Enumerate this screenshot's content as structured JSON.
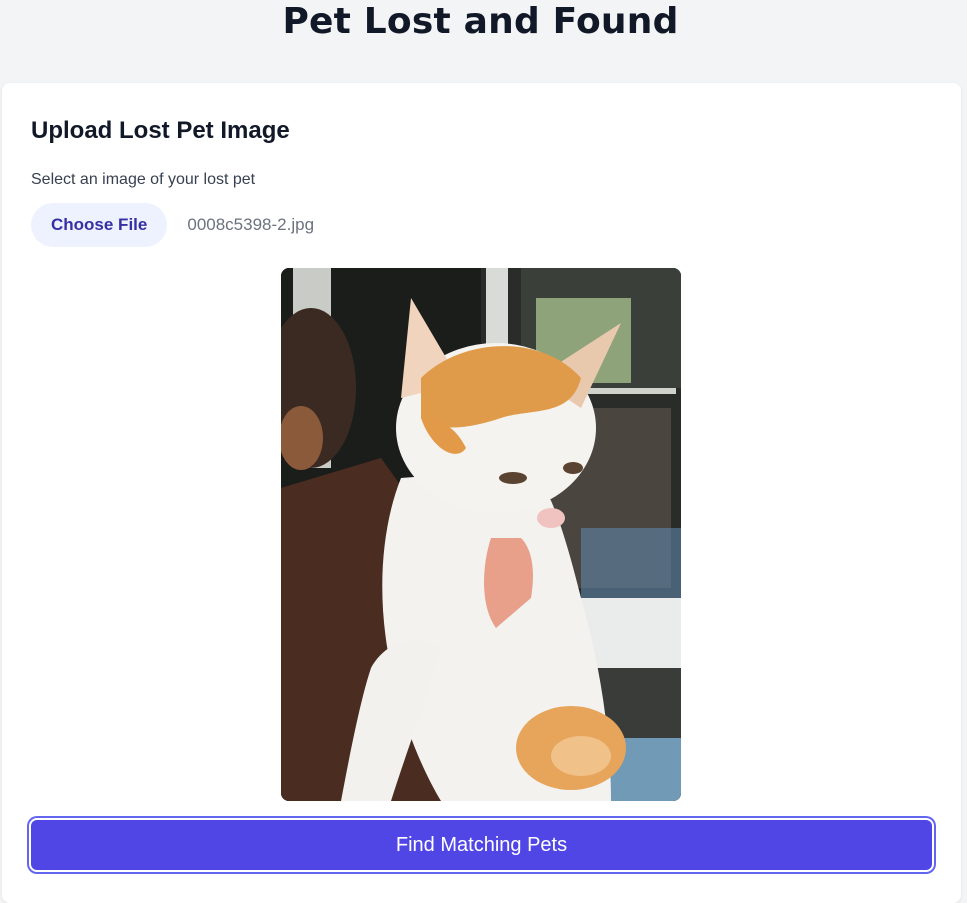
{
  "header": {
    "title": "Pet Lost and Found"
  },
  "upload": {
    "heading": "Upload Lost Pet Image",
    "label": "Select an image of your lost pet",
    "choose_file_label": "Choose File",
    "file_name": "0008c5398-2.jpg",
    "preview_icon": "cat-photo-preview"
  },
  "actions": {
    "find_label": "Find Matching Pets"
  },
  "colors": {
    "accent": "#4f46e5",
    "choose_file_bg": "#eef2ff",
    "choose_file_text": "#3730a3",
    "page_bg": "#f3f4f6"
  }
}
